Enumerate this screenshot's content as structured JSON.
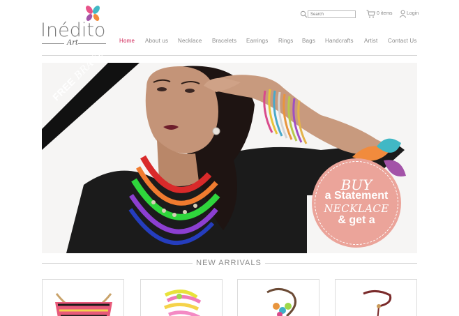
{
  "brand": {
    "name": "Inédito",
    "sub": "Art",
    "colors": {
      "accent": "#cf1f53",
      "badge": "#eba49a",
      "ribbon": "#111111"
    }
  },
  "header": {
    "search_placeholder": "Search",
    "cart_text": "0 items",
    "login_text": "Login",
    "icons": [
      "search-icon",
      "cart-icon",
      "user-icon"
    ]
  },
  "nav": {
    "items": [
      {
        "label": "Home",
        "active": true
      },
      {
        "label": "About us"
      },
      {
        "label": "Necklace"
      },
      {
        "label": "Bracelets"
      },
      {
        "label": "Earrings"
      },
      {
        "label": "Rings"
      },
      {
        "label": "Bags"
      },
      {
        "label": "Handcrafts"
      },
      {
        "label": "Artist"
      },
      {
        "label": "Contact Us"
      }
    ]
  },
  "hero": {
    "ribbon": {
      "bold": "FREE",
      "italic": "BRACELET"
    },
    "badge": {
      "line1": "BUY",
      "line2": "a Statement",
      "line3": "NECKLACE",
      "line4": "& get a"
    }
  },
  "arrivals": {
    "title": "NEW ARRIVALS",
    "products": [
      {
        "name": "product-necklace-bib"
      },
      {
        "name": "product-bracelet-neon"
      },
      {
        "name": "product-necklace-beads"
      },
      {
        "name": "product-necklace-cord"
      }
    ]
  }
}
